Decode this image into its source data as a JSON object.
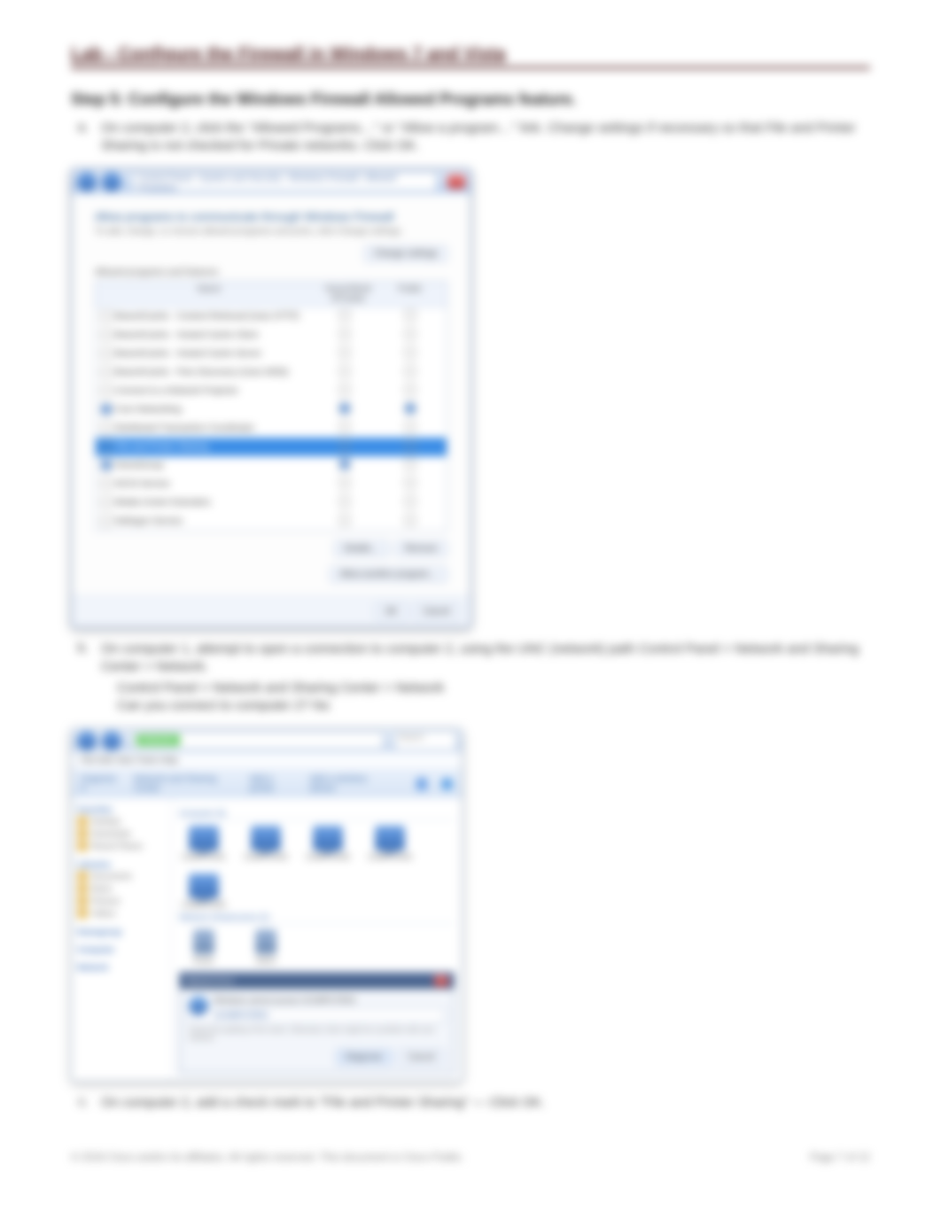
{
  "header": {
    "title": "Lab - Configure the Firewall in Windows 7 and Vista"
  },
  "step": {
    "title": "Step 5: Configure the Windows Firewall Allowed Programs feature.",
    "items": [
      "On computer 2, click the \"Allowed Programs…\" or \"Allow a program…\" link. Change settings if necessary so that File and Printer Sharing is not checked for Private networks. Click OK.",
      "On computer 1, attempt to open a connection to computer 2, using the UNC (network) path Control Panel > Network and Sharing Center > Network.",
      "On computer 2, add a check mark to \"File and Printer Sharing\" — Click OK."
    ],
    "indent_lines": [
      "Control Panel > Network and Sharing Center > Network",
      "Can you connect to computer 2? No"
    ]
  },
  "screenshot1": {
    "address": "Control Panel › System and Security › Windows Firewall › Allowed Programs",
    "panel_title": "Allow programs to communicate through Windows Firewall",
    "panel_sub": "To add, change, or remove allowed programs and ports, click Change settings.",
    "change_btn": "Change settings",
    "list_label": "Allowed programs and features:",
    "columns": [
      "Name",
      "Home/Work (Private)",
      "Public"
    ],
    "rows": [
      {
        "name": "BranchCache - Content Retrieval (Uses HTTP)",
        "priv": false,
        "pub": false,
        "sel": false
      },
      {
        "name": "BranchCache - Hosted Cache Client",
        "priv": false,
        "pub": false,
        "sel": false
      },
      {
        "name": "BranchCache - Hosted Cache Server",
        "priv": false,
        "pub": false,
        "sel": false
      },
      {
        "name": "BranchCache - Peer Discovery (Uses WSD)",
        "priv": false,
        "pub": false,
        "sel": false
      },
      {
        "name": "Connect to a Network Projector",
        "priv": false,
        "pub": false,
        "sel": false
      },
      {
        "name": "Core Networking",
        "priv": true,
        "pub": true,
        "sel": false
      },
      {
        "name": "Distributed Transaction Coordinator",
        "priv": false,
        "pub": false,
        "sel": false
      },
      {
        "name": "File and Printer Sharing",
        "priv": false,
        "pub": false,
        "sel": true
      },
      {
        "name": "HomeGroup",
        "priv": true,
        "pub": false,
        "sel": false
      },
      {
        "name": "iSCSI Service",
        "priv": false,
        "pub": false,
        "sel": false
      },
      {
        "name": "Media Center Extenders",
        "priv": false,
        "pub": false,
        "sel": false
      },
      {
        "name": "Netlogon Service",
        "priv": false,
        "pub": false,
        "sel": false
      }
    ],
    "details_btn": "Details…",
    "remove_btn": "Remove",
    "allow_another": "Allow another program…",
    "ok": "OK",
    "cancel": "Cancel"
  },
  "screenshot2": {
    "address_chip": "Network",
    "search_ph": "Search",
    "menu": "File   Edit   View   Tools   Help",
    "toolbar": [
      "Organize ▾",
      "Network and Sharing Center",
      "Add a printer",
      "Add a wireless device"
    ],
    "side_groups": [
      {
        "title": "Favorites",
        "items": [
          "Desktop",
          "Downloads",
          "Recent Places"
        ]
      },
      {
        "title": "Libraries",
        "items": [
          "Documents",
          "Music",
          "Pictures",
          "Videos"
        ]
      },
      {
        "title": "Homegroup",
        "items": []
      },
      {
        "title": "Computer",
        "items": []
      },
      {
        "title": "Network",
        "items": []
      }
    ],
    "section1": "Computer (5)",
    "computers": [
      "COMPUTER1",
      "COMPUTER2",
      "COMPUTER3",
      "COMPUTER4",
      "COMPUTER5"
    ],
    "section2": "Network Infrastructure (2)",
    "devices": [
      "Router",
      "Switch"
    ],
    "dialog": {
      "title": "Network Error",
      "heading": "Windows cannot access \\\\COMPUTER2",
      "path": "\\\\COMPUTER2",
      "example": "Check the spelling of the name. Otherwise, there might be a problem with your network.",
      "diagnose": "Diagnose",
      "cancel": "Cancel"
    }
  },
  "footer": {
    "left": "© 2016 Cisco and/or its affiliates. All rights reserved. This document is Cisco Public.",
    "right": "Page 7 of 12"
  }
}
